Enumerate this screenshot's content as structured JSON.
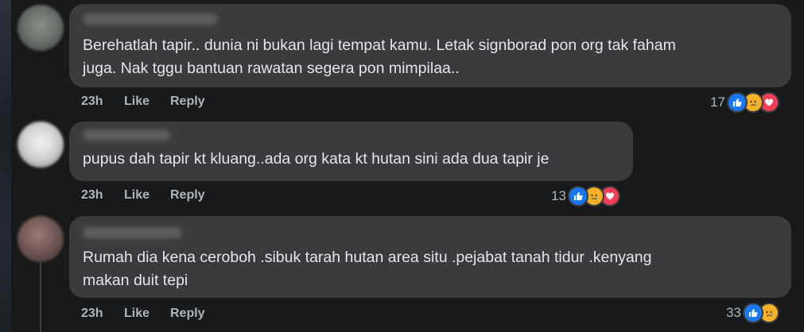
{
  "comments": [
    {
      "text": "Berehatlah tapir.. dunia ni bukan lagi tempat kamu. Letak signborad pon org tak faham juga. Nak tggu bantuan rawatan segera pon mimpilaa..",
      "line1": "Berehatlah tapir.. dunia ni bukan lagi tempat kamu. Letak signborad pon org tak faham",
      "line2": "juga. Nak tggu bantuan rawatan segera pon mimpilaa..",
      "time": "23h",
      "like_label": "Like",
      "reply_label": "Reply",
      "reaction_count": "17",
      "reactions": [
        "like-icon",
        "sad-icon",
        "love-icon"
      ]
    },
    {
      "text": "pupus dah tapir kt kluang..ada org kata kt hutan sini ada dua tapir je",
      "line1": "pupus dah tapir kt kluang..ada org kata kt hutan sini ada dua tapir je",
      "time": "23h",
      "like_label": "Like",
      "reply_label": "Reply",
      "reaction_count": "13",
      "reactions": [
        "like-icon",
        "sad-icon",
        "love-icon"
      ]
    },
    {
      "text": "Rumah dia kena ceroboh .sibuk tarah hutan area situ .pejabat tanah tidur .kenyang makan duit tepi",
      "line1": "Rumah dia kena ceroboh .sibuk tarah hutan area situ .pejabat tanah tidur .kenyang",
      "line2": "makan duit tepi",
      "time": "23h",
      "like_label": "Like",
      "reply_label": "Reply",
      "reaction_count": "33",
      "reactions": [
        "like-icon",
        "sad-icon"
      ]
    }
  ],
  "colors": {
    "background": "#18191a",
    "bubble": "#3a3b3c",
    "text": "#e4e6eb",
    "secondary": "#b0b3b8",
    "like": "#1877f2",
    "sad": "#f7b125",
    "love": "#f33e58"
  }
}
